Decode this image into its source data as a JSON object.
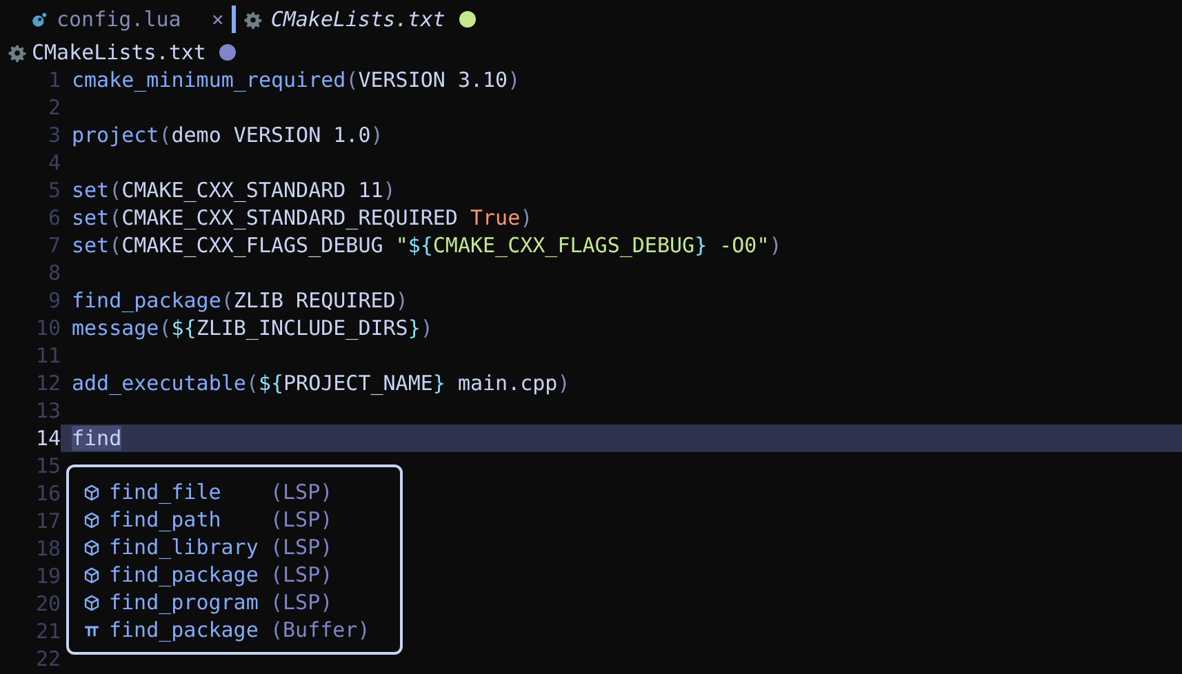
{
  "tabs": [
    {
      "label": "config.lua",
      "kind": "lua",
      "selected": false,
      "modified": false,
      "close": "×"
    },
    {
      "label": "CMakeLists.txt",
      "kind": "gear",
      "selected": true,
      "modified": true
    }
  ],
  "winbar": {
    "title": "CMakeLists.txt",
    "kind": "gear",
    "modified": true
  },
  "lines": [
    {
      "number": "1",
      "current": false,
      "segments": [
        {
          "kind": "fn",
          "text": "cmake_minimum_required"
        },
        {
          "kind": "paren",
          "text": "("
        },
        {
          "kind": "plain",
          "text": "VERSION 3.10"
        },
        {
          "kind": "paren",
          "text": ")"
        }
      ]
    },
    {
      "number": "2",
      "current": false
    },
    {
      "number": "3",
      "current": false,
      "segments": [
        {
          "kind": "fn",
          "text": "project"
        },
        {
          "kind": "paren",
          "text": "("
        },
        {
          "kind": "plain",
          "text": "demo VERSION 1.0"
        },
        {
          "kind": "paren",
          "text": ")"
        }
      ]
    },
    {
      "number": "4",
      "current": false
    },
    {
      "number": "5",
      "current": false,
      "segments": [
        {
          "kind": "fn",
          "text": "set"
        },
        {
          "kind": "paren",
          "text": "("
        },
        {
          "kind": "plain",
          "text": "CMAKE_CXX_STANDARD 11"
        },
        {
          "kind": "paren",
          "text": ")"
        }
      ]
    },
    {
      "number": "6",
      "current": false,
      "segments": [
        {
          "kind": "fn",
          "text": "set"
        },
        {
          "kind": "paren",
          "text": "("
        },
        {
          "kind": "plain",
          "text": "CMAKE_CXX_STANDARD_REQUIRED "
        },
        {
          "kind": "bool",
          "text": "True"
        },
        {
          "kind": "paren",
          "text": ")"
        }
      ]
    },
    {
      "number": "7",
      "current": false,
      "segments": [
        {
          "kind": "fn",
          "text": "set"
        },
        {
          "kind": "paren",
          "text": "("
        },
        {
          "kind": "plain",
          "text": "CMAKE_CXX_FLAGS_DEBUG "
        },
        {
          "kind": "string",
          "text": "\""
        },
        {
          "kind": "var",
          "text": "${"
        },
        {
          "kind": "string",
          "text": "CMAKE_CXX_FLAGS_DEBUG"
        },
        {
          "kind": "var",
          "text": "}"
        },
        {
          "kind": "string",
          "text": " -O0\""
        },
        {
          "kind": "paren",
          "text": ")"
        }
      ]
    },
    {
      "number": "8",
      "current": false
    },
    {
      "number": "9",
      "current": false,
      "segments": [
        {
          "kind": "fn",
          "text": "find_package"
        },
        {
          "kind": "paren",
          "text": "("
        },
        {
          "kind": "plain",
          "text": "ZLIB REQUIRED"
        },
        {
          "kind": "paren",
          "text": ")"
        }
      ]
    },
    {
      "number": "10",
      "current": false,
      "segments": [
        {
          "kind": "fn",
          "text": "message"
        },
        {
          "kind": "paren",
          "text": "("
        },
        {
          "kind": "var",
          "text": "${"
        },
        {
          "kind": "plain",
          "text": "ZLIB_INCLUDE_DIRS"
        },
        {
          "kind": "var",
          "text": "}"
        },
        {
          "kind": "paren",
          "text": ")"
        }
      ]
    },
    {
      "number": "11",
      "current": false
    },
    {
      "number": "12",
      "current": false,
      "segments": [
        {
          "kind": "fn",
          "text": "add_executable"
        },
        {
          "kind": "paren",
          "text": "("
        },
        {
          "kind": "var",
          "text": "${"
        },
        {
          "kind": "plain",
          "text": "PROJECT_NAME"
        },
        {
          "kind": "var",
          "text": "}"
        },
        {
          "kind": "plain",
          "text": " main.cpp"
        },
        {
          "kind": "paren",
          "text": ")"
        }
      ]
    },
    {
      "number": "13",
      "current": false
    },
    {
      "number": "14",
      "current": true,
      "segments": [
        {
          "kind": "match",
          "text": "find"
        }
      ]
    },
    {
      "number": "15",
      "current": false
    },
    {
      "number": "16",
      "current": false
    },
    {
      "number": "17",
      "current": false
    },
    {
      "number": "18",
      "current": false
    },
    {
      "number": "19",
      "current": false
    },
    {
      "number": "20",
      "current": false
    },
    {
      "number": "21",
      "current": false
    },
    {
      "number": "22",
      "current": false
    }
  ],
  "completion": {
    "items": [
      {
        "kind": "module",
        "label": "find_file",
        "source": "(LSP)"
      },
      {
        "kind": "module",
        "label": "find_path",
        "source": "(LSP)"
      },
      {
        "kind": "module",
        "label": "find_library",
        "source": "(LSP)"
      },
      {
        "kind": "module",
        "label": "find_package",
        "source": "(LSP)"
      },
      {
        "kind": "module",
        "label": "find_program",
        "source": "(LSP)"
      },
      {
        "kind": "text",
        "label": "find_package",
        "source": "(Buffer)"
      }
    ]
  }
}
